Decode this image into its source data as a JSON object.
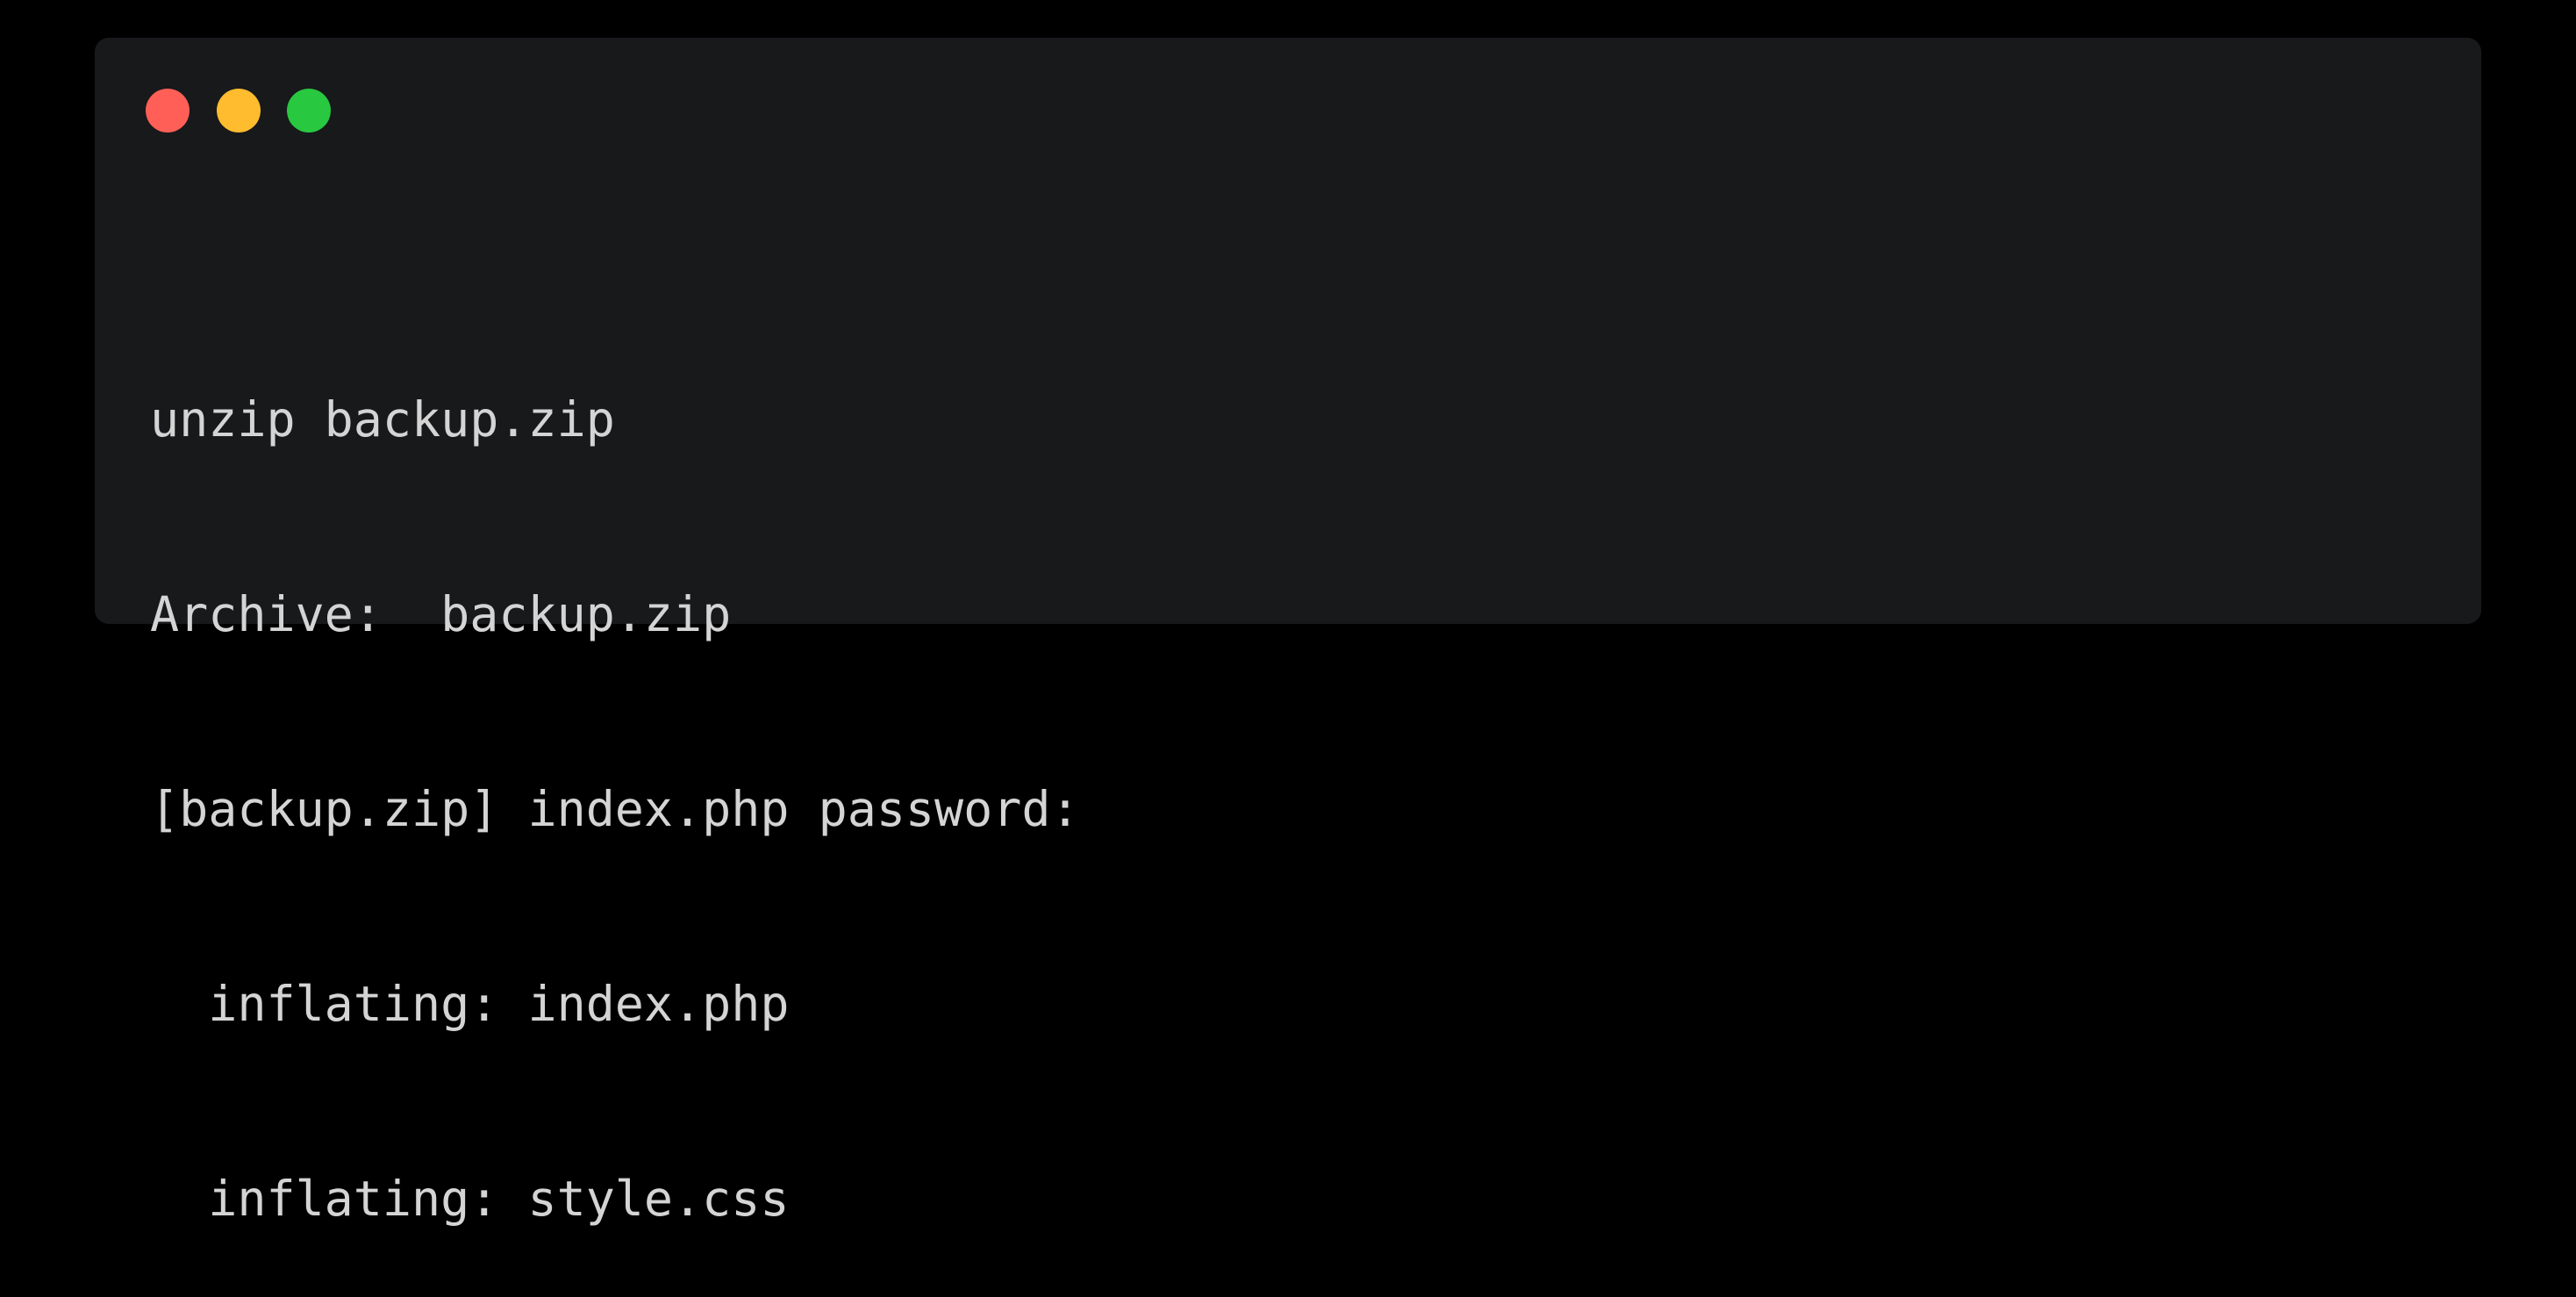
{
  "window": {
    "controls": {
      "close_color": "#ff5f57",
      "minimize_color": "#febc2e",
      "maximize_color": "#28c840"
    }
  },
  "terminal": {
    "lines": [
      "unzip backup.zip",
      "Archive:  backup.zip",
      "[backup.zip] index.php password:",
      "  inflating: index.php",
      "  inflating: style.css"
    ]
  }
}
